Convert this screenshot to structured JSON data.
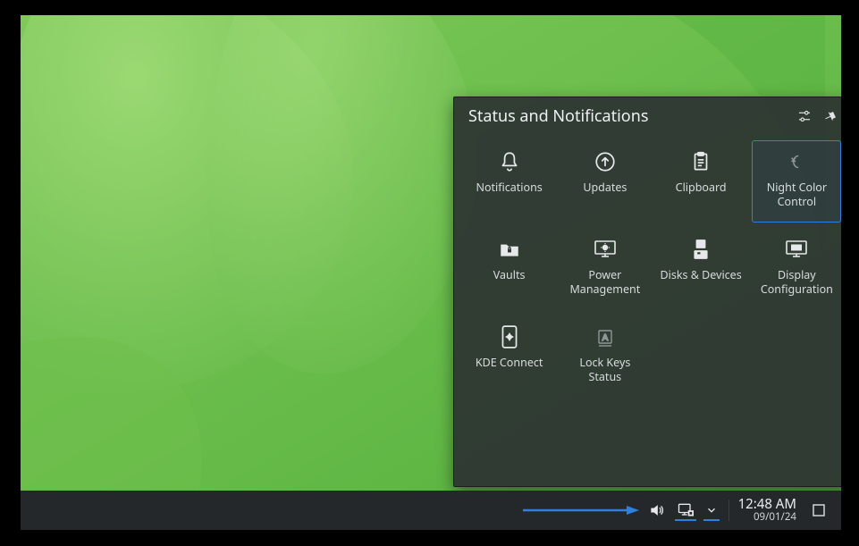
{
  "popup": {
    "title": "Status and Notifications",
    "tiles": [
      {
        "label": "Notifications"
      },
      {
        "label": "Updates"
      },
      {
        "label": "Clipboard"
      },
      {
        "label": "Night Color\nControl",
        "selected": true
      },
      {
        "label": "Vaults"
      },
      {
        "label": "Power\nManagement"
      },
      {
        "label": "Disks & Devices"
      },
      {
        "label": "Display\nConfiguration"
      },
      {
        "label": "KDE Connect"
      },
      {
        "label": "Lock Keys\nStatus"
      }
    ]
  },
  "taskbar": {
    "time": "12:48 AM",
    "date": "09/01/24"
  }
}
